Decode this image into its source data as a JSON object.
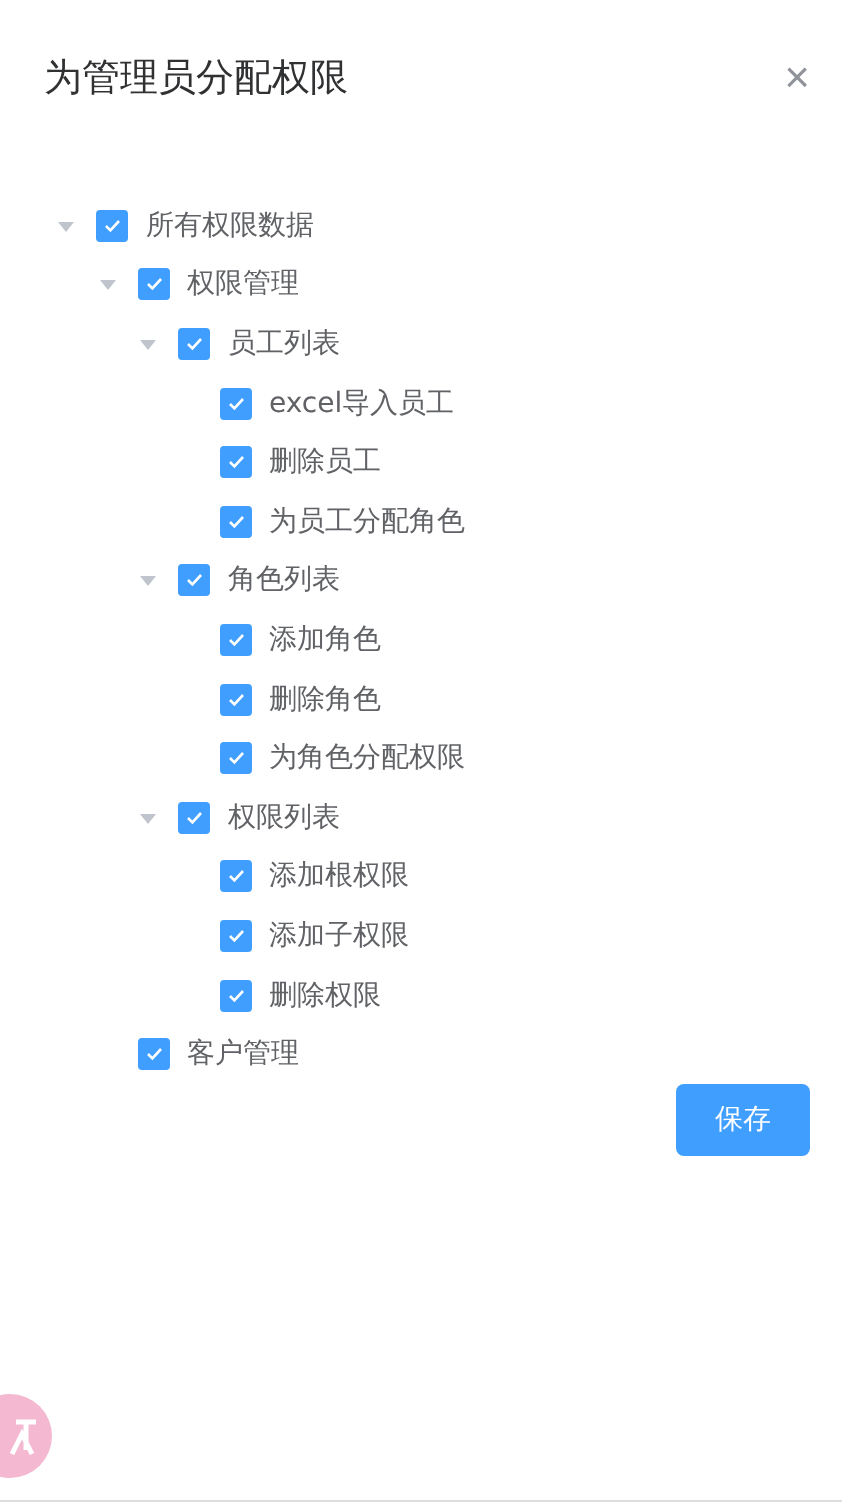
{
  "dialog": {
    "title": "为管理员分配权限",
    "close": "×"
  },
  "tree": [
    {
      "label": "所有权限数据",
      "checked": true,
      "expanded": true,
      "children": [
        {
          "label": "权限管理",
          "checked": true,
          "expanded": true,
          "children": [
            {
              "label": "员工列表",
              "checked": true,
              "expanded": true,
              "children": [
                {
                  "label": "excel导入员工",
                  "checked": true
                },
                {
                  "label": "删除员工",
                  "checked": true
                },
                {
                  "label": "为员工分配角色",
                  "checked": true
                }
              ]
            },
            {
              "label": "角色列表",
              "checked": true,
              "expanded": true,
              "children": [
                {
                  "label": "添加角色",
                  "checked": true
                },
                {
                  "label": "删除角色",
                  "checked": true
                },
                {
                  "label": "为角色分配权限",
                  "checked": true
                }
              ]
            },
            {
              "label": "权限列表",
              "checked": true,
              "expanded": true,
              "children": [
                {
                  "label": "添加根权限",
                  "checked": true
                },
                {
                  "label": "添加子权限",
                  "checked": true
                },
                {
                  "label": "删除权限",
                  "checked": true
                }
              ]
            }
          ]
        },
        {
          "label": "客户管理",
          "checked": true
        }
      ]
    }
  ],
  "save_button": "保存"
}
